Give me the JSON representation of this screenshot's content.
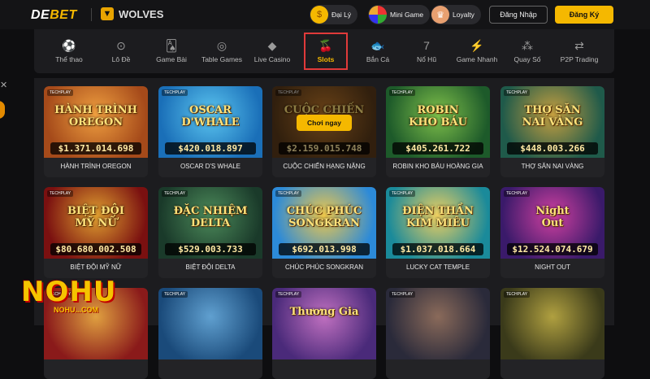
{
  "header": {
    "logo_primary": "DE",
    "logo_accent": "BET",
    "partner": "WOLVES",
    "promos": [
      {
        "label": "Đại Lý",
        "icon": "coin-icon"
      },
      {
        "label": "Mini Game",
        "icon": "wheel-icon"
      },
      {
        "label": "Loyalty",
        "icon": "crown-icon"
      }
    ],
    "login_label": "Đăng Nhập",
    "register_label": "Đăng Ký"
  },
  "categories": [
    {
      "label": "Thể thao",
      "icon": "soccer-ball-icon",
      "glyph": "⚽",
      "active": false
    },
    {
      "label": "Lô Đề",
      "icon": "lottery-balls-icon",
      "glyph": "⊙",
      "active": false
    },
    {
      "label": "Game Bài",
      "icon": "cards-icon",
      "glyph": "🂡",
      "active": false
    },
    {
      "label": "Table Games",
      "icon": "chips-icon",
      "glyph": "◎",
      "active": false
    },
    {
      "label": "Live Casino",
      "icon": "diamond-icon",
      "glyph": "◆",
      "active": false
    },
    {
      "label": "Slots",
      "icon": "cherry-icon",
      "glyph": "🍒",
      "active": true
    },
    {
      "label": "Bắn Cá",
      "icon": "fish-icon",
      "glyph": "🐟",
      "active": false
    },
    {
      "label": "Nổ Hũ",
      "icon": "seven-icon",
      "glyph": "7",
      "active": false
    },
    {
      "label": "Game Nhanh",
      "icon": "lightning-icon",
      "glyph": "⚡",
      "active": false
    },
    {
      "label": "Quay Số",
      "icon": "lottery-icon",
      "glyph": "⁂",
      "active": false
    },
    {
      "label": "P2P Trading",
      "icon": "p2p-icon",
      "glyph": "⇄",
      "active": false
    }
  ],
  "games": [
    {
      "name": "HÀNH TRÌNH OREGON",
      "art_title": "HÀNH TRÌNH\nOREGON",
      "jackpot": "$1.371.014.698",
      "bg1": "#a54a1a",
      "bg2": "#f0a040",
      "hover": false
    },
    {
      "name": "OSCAR D'S WHALE",
      "art_title": "OSCAR\nD'WHALE",
      "jackpot": "$420.018.897",
      "bg1": "#1a6fb8",
      "bg2": "#5cc6f0",
      "hover": false
    },
    {
      "name": "CUỘC CHIẾN HẠNG NẶNG",
      "art_title": "CUỘC CHIẾN",
      "jackpot": "$2.159.015.748",
      "bg1": "#5a3a1a",
      "bg2": "#c0782a",
      "hover": true,
      "play_label": "Chơi ngay"
    },
    {
      "name": "ROBIN KHO BÁU HOÀNG GIA",
      "art_title": "ROBIN\nKHO BÁU",
      "jackpot": "$405.261.722",
      "bg1": "#1d5a2a",
      "bg2": "#7fc04a",
      "hover": false
    },
    {
      "name": "THỢ SĂN NAI VÀNG",
      "art_title": "THỢ SĂN\nNAI VÀNG",
      "jackpot": "$448.003.266",
      "bg1": "#1f5a4a",
      "bg2": "#c8a040",
      "hover": false
    },
    {
      "name": "BIỆT ĐỘI MỸ NỮ",
      "art_title": "BIỆT ĐỘI\nMỸ NỮ",
      "jackpot": "$80.680.002.508",
      "bg1": "#7a1010",
      "bg2": "#e0a030",
      "hover": false
    },
    {
      "name": "BIỆT ĐỘI DELTA",
      "art_title": "ĐẶC NHIỆM\nDELTA",
      "jackpot": "$529.003.733",
      "bg1": "#1a3a2a",
      "bg2": "#4c8a5a",
      "hover": false
    },
    {
      "name": "CHÚC PHÚC SONGKRAN",
      "art_title": "CHÚC PHÚC\nSONGKRAN",
      "jackpot": "$692.013.998",
      "bg1": "#2c8ad8",
      "bg2": "#f0c84a",
      "hover": false
    },
    {
      "name": "LUCKY CAT TEMPLE",
      "art_title": "ĐIỆN THẦN\nKIM MIÊU",
      "jackpot": "$1.037.018.664",
      "bg1": "#1a8a9a",
      "bg2": "#f0d060",
      "hover": false
    },
    {
      "name": "NIGHT OUT",
      "art_title": "Night\nOut",
      "jackpot": "$12.524.074.679",
      "bg1": "#3a1a6a",
      "bg2": "#d040a0",
      "hover": false
    },
    {
      "name": "",
      "art_title": "",
      "jackpot": "",
      "bg1": "#8a1a1a",
      "bg2": "#e0a040",
      "hover": false
    },
    {
      "name": "",
      "art_title": "",
      "jackpot": "",
      "bg1": "#1a4a7a",
      "bg2": "#60a0d0",
      "hover": false
    },
    {
      "name": "",
      "art_title": "Thương Gia",
      "jackpot": "",
      "bg1": "#4a2a7a",
      "bg2": "#c070c0",
      "hover": false
    },
    {
      "name": "",
      "art_title": "",
      "jackpot": "",
      "bg1": "#2a2a3a",
      "bg2": "#8a6a5a",
      "hover": false
    },
    {
      "name": "",
      "art_title": "",
      "jackpot": "",
      "bg1": "#3a3a1a",
      "bg2": "#b0a040",
      "hover": false
    }
  ],
  "watermark": {
    "line1": "NOHU",
    "line2": "NOHU...COM"
  },
  "colors": {
    "accent": "#f5b800",
    "highlight": "#e03a3a",
    "panel": "#1c1c1f"
  }
}
